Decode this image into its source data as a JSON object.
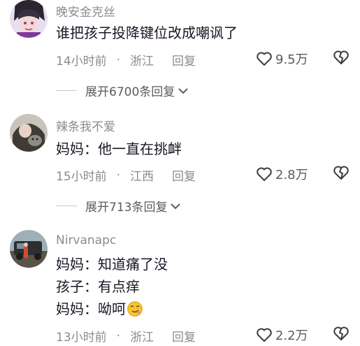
{
  "comments": [
    {
      "username": "晚安金克丝",
      "lines": [
        "谁把孩子投降键位改成嘲讽了"
      ],
      "time": "14小时前",
      "location": "浙江",
      "reply_label": "回复",
      "likes": "9.5万",
      "expand_label": "展开6700条回复"
    },
    {
      "username": "辣条我不爱",
      "lines": [
        "妈妈：他一直在挑衅"
      ],
      "time": "15小时前",
      "location": "江西",
      "reply_label": "回复",
      "likes": "2.8万",
      "expand_label": "展开713条回复"
    },
    {
      "username": "Nirvanapc",
      "lines": [
        "妈妈：知道痛了没",
        "孩子：有点痒",
        "妈妈：呦呵"
      ],
      "time": "13小时前",
      "location": "浙江",
      "reply_label": "回复",
      "likes": "2.2万"
    }
  ],
  "separator": "·",
  "icons": {
    "like": "heart-outline-icon",
    "dislike": "broken-heart-icon",
    "expand": "chevron-down-icon",
    "emoji": "smirk-emoji-icon"
  },
  "colors": {
    "text": "#161823",
    "muted": "#8a8b91",
    "secondary": "#5a5b61"
  }
}
